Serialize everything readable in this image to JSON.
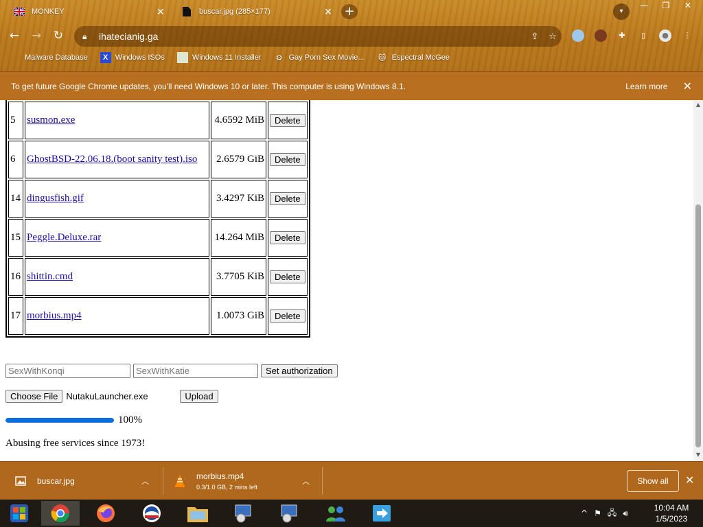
{
  "tabs": [
    {
      "title": "MONKEY",
      "icon": "union-jack-icon",
      "active": true
    },
    {
      "title": "buscar.jpg (285×177)",
      "icon": "image-file-icon",
      "active": false
    }
  ],
  "address": {
    "url": "ihatecianig.ga"
  },
  "bookmarks": [
    {
      "label": "Malware Database",
      "icon": "folder-icon"
    },
    {
      "label": "Windows ISOs",
      "icon": "x-logo-icon"
    },
    {
      "label": "Windows 11 Installer",
      "icon": "image-icon"
    },
    {
      "label": "Gay Porn Sex Movie...",
      "icon": "gear-icon"
    },
    {
      "label": "Espectral McGee",
      "icon": "cat-icon"
    }
  ],
  "infobar": {
    "message": "To get future Google Chrome updates, you'll need Windows 10 or later. This computer is using Windows 8.1.",
    "learn_more": "Learn more"
  },
  "files": [
    {
      "id": "5",
      "name": "susmon.exe",
      "size": "4.6592 MiB",
      "action": "Delete"
    },
    {
      "id": "6",
      "name": "GhostBSD-22.06.18.(boot sanity test).iso",
      "size": "2.6579 GiB",
      "action": "Delete"
    },
    {
      "id": "14",
      "name": "dingusfish.gif",
      "size": "3.4297 KiB",
      "action": "Delete"
    },
    {
      "id": "15",
      "name": "Peggle.Deluxe.rar",
      "size": "14.264 MiB",
      "action": "Delete"
    },
    {
      "id": "16",
      "name": "shittin.cmd",
      "size": "3.7705 KiB",
      "action": "Delete"
    },
    {
      "id": "17",
      "name": "morbius.mp4",
      "size": "1.0073 GiB",
      "action": "Delete"
    }
  ],
  "auth": {
    "user_placeholder": "SexWithKonqi",
    "pass_placeholder": "SexWithKatie",
    "button": "Set authorization"
  },
  "upload": {
    "choose_label": "Choose File",
    "file_name": "NutakuLauncher.exe",
    "button": "Upload",
    "progress": 1.0,
    "progress_text": "100%"
  },
  "footer": "Abusing free services since 1973!",
  "downloads": [
    {
      "name": "buscar.jpg",
      "status": "",
      "icon": "image-file-icon"
    },
    {
      "name": "morbius.mp4",
      "status": "0.3/1.0 GB, 2 mins left",
      "icon": "vlc-cone-icon"
    }
  ],
  "shelf": {
    "show_all": "Show all"
  },
  "clock": {
    "time": "10:04 AM",
    "date": "1/5/2023"
  },
  "colors": {
    "progress": "#0a6fdc",
    "link": "#1a0dab",
    "frame": "#b8761c"
  }
}
